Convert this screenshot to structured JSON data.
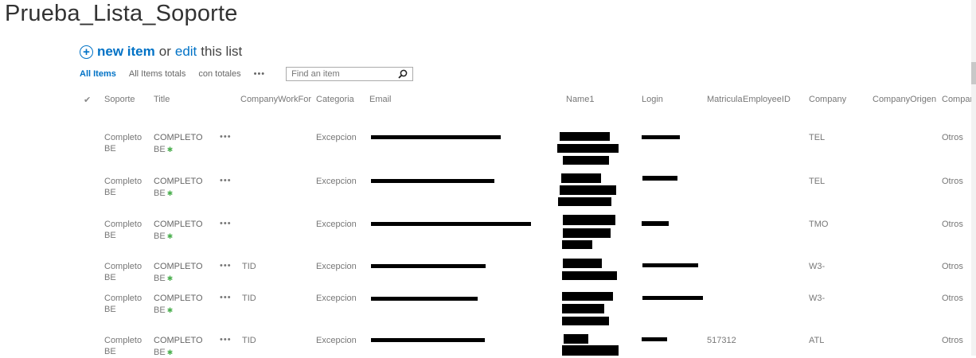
{
  "page": {
    "title": "Prueba_Lista_Soporte"
  },
  "hero": {
    "plus": "+",
    "new_item": "new item",
    "or": "or",
    "edit": "edit",
    "this_list": "this list"
  },
  "views": {
    "items": [
      "All Items",
      "All Items totals",
      "con totales"
    ],
    "more": "•••",
    "search_placeholder": "Find an item"
  },
  "columns": {
    "check": "✔",
    "soporte": "Soporte",
    "title": "Title",
    "companyworkfor": "CompanyWorkFor",
    "categoria": "Categoria",
    "email": "Email",
    "name1": "Name1",
    "login": "Login",
    "matricula": "Matricula",
    "employeeid": "EmployeeID",
    "company": "Company",
    "companyorigen": "CompanyOrigen",
    "company2": "Company"
  },
  "rows": [
    {
      "soporte1": "Completo",
      "soporte2": "BE",
      "title1": "COMPLETO",
      "title2": "BE",
      "menu": "•••",
      "companyworkfor": "",
      "categoria": "Excepcion",
      "matricula": "",
      "company": "TEL",
      "otros": "Otros"
    },
    {
      "soporte1": "Completo",
      "soporte2": "BE",
      "title1": "COMPLETO",
      "title2": "BE",
      "menu": "•••",
      "companyworkfor": "",
      "categoria": "Excepcion",
      "matricula": "",
      "company": "TEL",
      "otros": "Otros"
    },
    {
      "soporte1": "Completo",
      "soporte2": "BE",
      "title1": "COMPLETO",
      "title2": "BE",
      "menu": "•••",
      "companyworkfor": "",
      "categoria": "Excepcion",
      "matricula": "",
      "company": "TMO",
      "otros": "Otros"
    },
    {
      "soporte1": "Completo",
      "soporte2": "BE",
      "title1": "COMPLETO",
      "title2": "BE",
      "menu": "•••",
      "companyworkfor": "TID",
      "categoria": "Excepcion",
      "matricula": "",
      "company": "W3-",
      "otros": "Otros"
    },
    {
      "soporte1": "Completo",
      "soporte2": "BE",
      "title1": "COMPLETO",
      "title2": "BE",
      "menu": "•••",
      "companyworkfor": "TID",
      "categoria": "Excepcion",
      "matricula": "",
      "company": "W3-",
      "otros": "Otros"
    },
    {
      "soporte1": "Completo",
      "soporte2": "BE",
      "title1": "COMPLETO",
      "title2": "BE",
      "menu": "•••",
      "companyworkfor": "TID",
      "categoria": "Excepcion",
      "matricula": "517312",
      "company": "ATL",
      "otros": "Otros"
    }
  ],
  "icons": {
    "new_item": "plus-circle-icon",
    "search": "magnifier-icon",
    "check": "checkmark-icon",
    "title_badge": "new-item-sparkle-icon"
  },
  "colors": {
    "link": "#0072c6",
    "badge": "#4caf50",
    "text": "#777777"
  }
}
